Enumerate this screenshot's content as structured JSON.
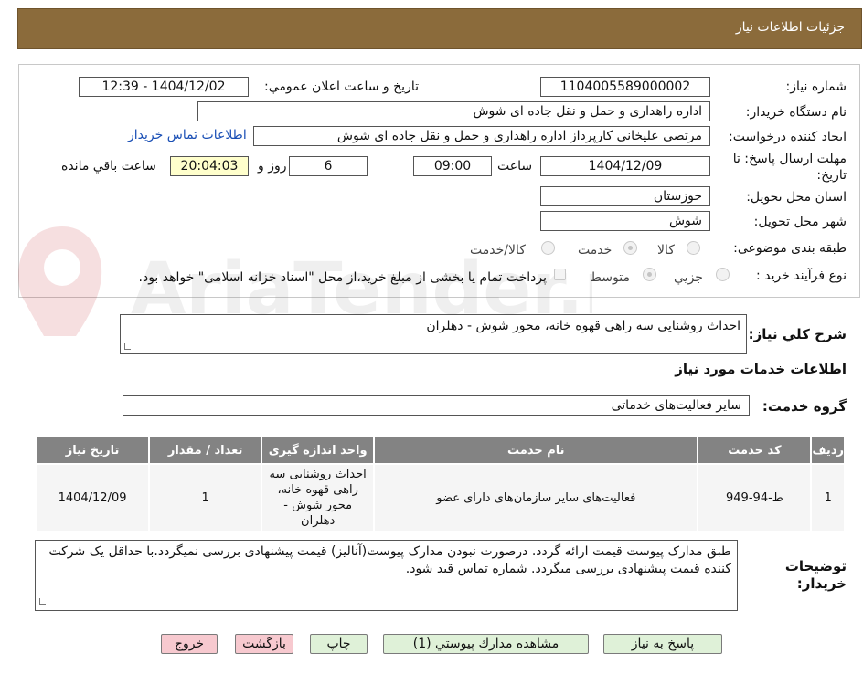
{
  "header": {
    "title": "جزئیات اطلاعات نیاز"
  },
  "form": {
    "need_number_label": "شماره نیاز:",
    "need_number": "1104005589000002",
    "announce_label": "تاریخ و ساعت اعلان عمومي:",
    "announce_value": "1404/12/02 - 12:39",
    "buyer_org_label": "نام دستگاه خريدار:",
    "buyer_org": "اداره راهداری و حمل و نقل جاده ای شوش",
    "requester_label": "ايجاد كننده درخواست:",
    "requester": "مرتضی علیخانی کارپرداز اداره راهداری و حمل و نقل جاده ای شوش",
    "contact_link": "اطلاعات تماس خريدار",
    "deadline_label_1": "مهلت ارسال پاسخ: تا",
    "deadline_label_2": "تاريخ:",
    "deadline_date": "1404/12/09",
    "time_label": "ساعت",
    "deadline_time": "09:00",
    "days_value": "6",
    "days_label": "روز و",
    "remaining_time": "20:04:03",
    "remaining_label": "ساعت باقي مانده",
    "province_label": "استان محل تحويل:",
    "province": "خوزستان",
    "city_label": "شهر محل تحويل:",
    "city": "شوش",
    "category_label": "طبقه بندی موضوعی:",
    "category_options": [
      "كالا",
      "خدمت",
      "كالا/خدمت"
    ],
    "category_selected": "خدمت",
    "process_label": "نوع فرآيند خريد :",
    "process_options": [
      "جزيي",
      "متوسط"
    ],
    "process_selected": "متوسط",
    "payment_note": "پرداخت تمام یا بخشی از مبلغ خرید،از محل \"اسناد خزانه اسلامی\" خواهد بود."
  },
  "description": {
    "label": "شرح كلي نياز:",
    "value": "احداث روشنایی سه راهی قهوه خانه، محور شوش - دهلران"
  },
  "services": {
    "section_title": "اطلاعات خدمات مورد نياز",
    "group_label": "گروه خدمت:",
    "group_value": "سایر فعالیت‌های خدماتی"
  },
  "table": {
    "headers": [
      "رديف",
      "كد خدمت",
      "نام خدمت",
      "واحد اندازه گيری",
      "تعداد / مقدار",
      "تاريخ نياز"
    ],
    "rows": [
      {
        "index": "1",
        "code": "ط-94-949",
        "name": "فعالیت‌های سایر سازمان‌های دارای عضو",
        "unit": "احداث روشنایی سه راهی قهوه خانه، محور شوش - دهلران",
        "quantity": "1",
        "date": "1404/12/09"
      }
    ]
  },
  "buyer_notes": {
    "label_1": "توضيحات",
    "label_2": "خريدار:",
    "value": "طبق مدارک پیوست قیمت ارائه گردد. درصورت نبودن مدارک پیوست(آنالیز) قیمت پیشنهادی بررسی نمیگردد.با حداقل یک شرکت کننده قیمت پیشنهادی بررسی میگردد. شماره تماس قید شود."
  },
  "buttons": {
    "reply": "پاسخ به نياز",
    "attachments": "مشاهده مدارك پيوستي (1)",
    "print": "چاپ",
    "back": "بازگشت",
    "exit": "خروج"
  },
  "watermark": {
    "text": "AriaTender.neT"
  },
  "colors": {
    "header": "#8b6b3b",
    "table_header": "#838383",
    "green_button": "#dff1d8",
    "pink_button": "#f7c9cf",
    "remaining_bg": "#ffffcc"
  }
}
